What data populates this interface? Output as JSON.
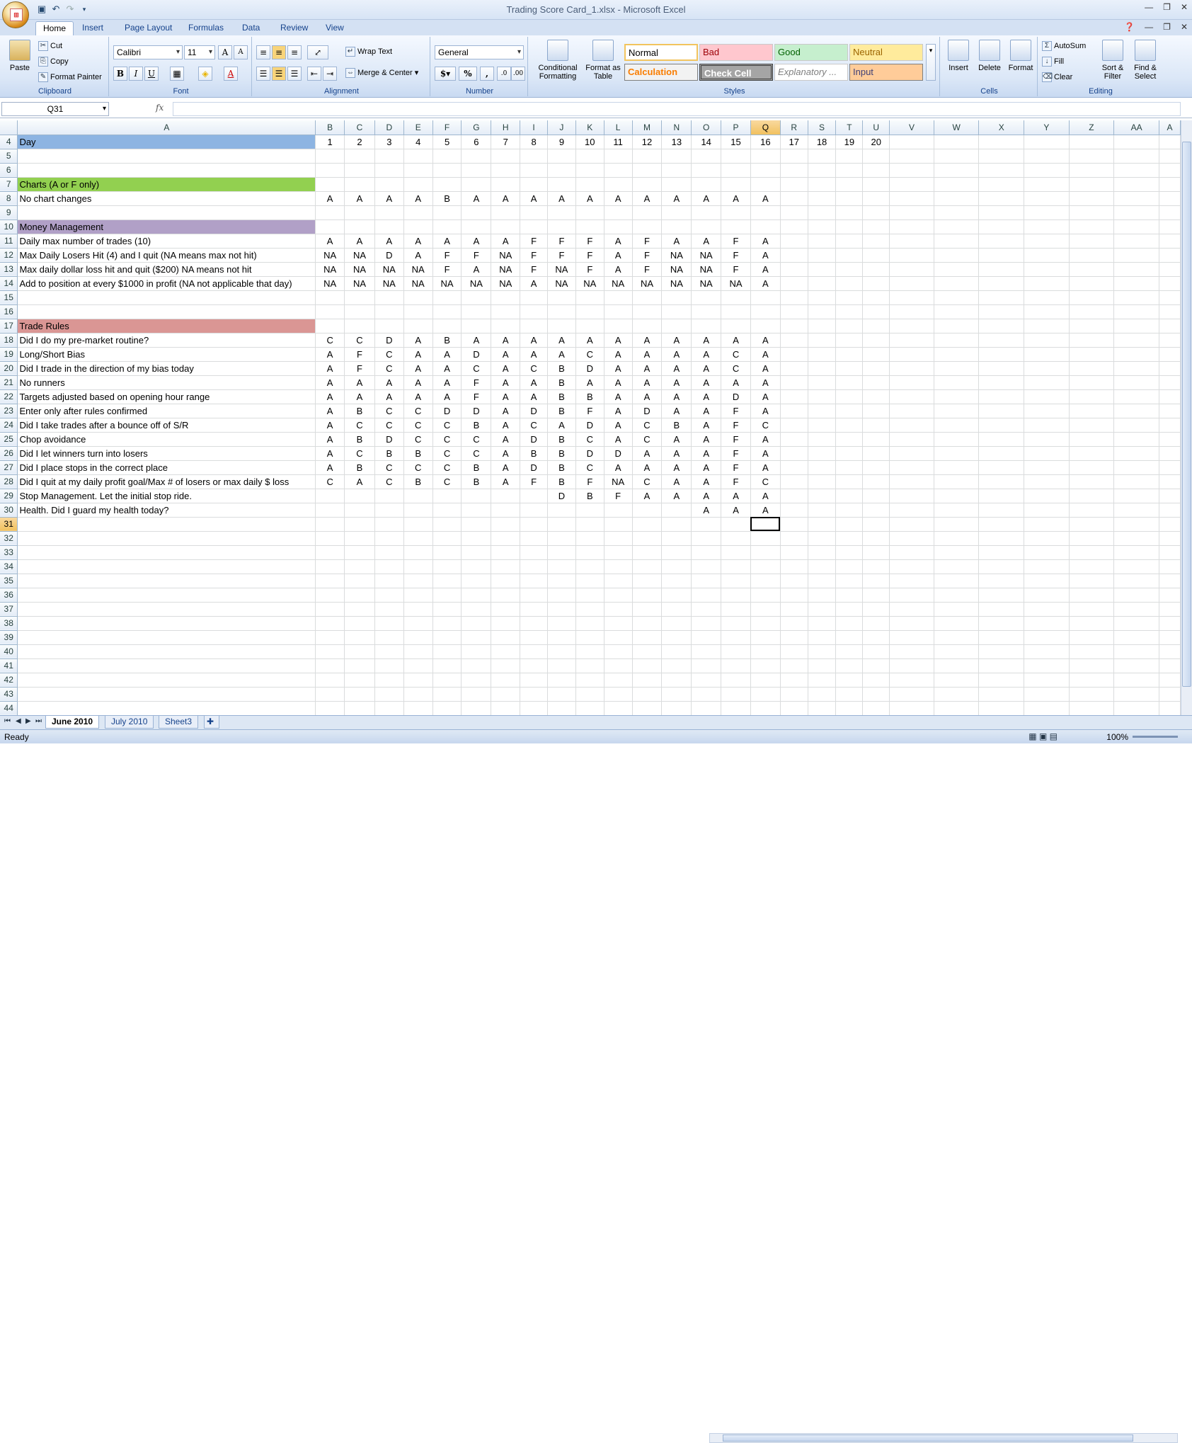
{
  "window": {
    "title": "Trading Score Card_1.xlsx - Microsoft Excel"
  },
  "ribbon_tabs": [
    "Home",
    "Insert",
    "Page Layout",
    "Formulas",
    "Data",
    "Review",
    "View"
  ],
  "clipboard": {
    "paste": "Paste",
    "cut": "Cut",
    "copy": "Copy",
    "format_painter": "Format Painter",
    "label": "Clipboard"
  },
  "font": {
    "name": "Calibri",
    "size": "11",
    "label": "Font"
  },
  "alignment": {
    "wrap": "Wrap Text",
    "merge": "Merge & Center",
    "label": "Alignment"
  },
  "number": {
    "format": "General",
    "label": "Number"
  },
  "styles": {
    "conditional": "Conditional Formatting",
    "format_table": "Format as Table",
    "normal": "Normal",
    "bad": "Bad",
    "good": "Good",
    "neutral": "Neutral",
    "calculation": "Calculation",
    "check_cell": "Check Cell",
    "explanatory": "Explanatory ...",
    "input": "Input",
    "label": "Styles",
    "colors": {
      "bad_bg": "#ffc7ce",
      "bad_fg": "#9c0006",
      "good_bg": "#c6efce",
      "good_fg": "#006100",
      "neutral_bg": "#ffeb9c",
      "neutral_fg": "#9c6500",
      "calc_fg": "#fa7d00",
      "check_bg": "#a5a5a5",
      "input_bg": "#ffcc99"
    }
  },
  "cells_group": {
    "insert": "Insert",
    "delete": "Delete",
    "format": "Format",
    "label": "Cells"
  },
  "editing": {
    "autosum": "AutoSum",
    "fill": "Fill",
    "clear": "Clear",
    "sort": "Sort & Filter",
    "find": "Find & Select",
    "label": "Editing"
  },
  "formula_bar": {
    "name_box": "Q31",
    "fx": "fx",
    "content": ""
  },
  "columns": [
    "A",
    "B",
    "C",
    "D",
    "E",
    "F",
    "G",
    "H",
    "I",
    "J",
    "K",
    "L",
    "M",
    "N",
    "O",
    "P",
    "Q",
    "R",
    "S",
    "T",
    "U",
    "V",
    "W",
    "X",
    "Y",
    "Z",
    "AA",
    "A"
  ],
  "selected_column": "Q",
  "selected_row": "31",
  "rows": [
    {
      "n": "4",
      "a": "Day",
      "fill": "#8db4e2",
      "v": [
        "1",
        "2",
        "3",
        "4",
        "5",
        "6",
        "7",
        "8",
        "9",
        "10",
        "11",
        "12",
        "13",
        "14",
        "15",
        "16",
        "17",
        "18",
        "19",
        "20"
      ]
    },
    {
      "n": "5",
      "a": "",
      "v": []
    },
    {
      "n": "6",
      "a": "",
      "v": []
    },
    {
      "n": "7",
      "a": "Charts   (A or F only)",
      "fill": "#92d050",
      "v": []
    },
    {
      "n": "8",
      "a": "No chart changes",
      "v": [
        "A",
        "A",
        "A",
        "A",
        "B",
        "A",
        "A",
        "A",
        "A",
        "A",
        "A",
        "A",
        "A",
        "A",
        "A",
        "A"
      ]
    },
    {
      "n": "9",
      "a": "",
      "v": []
    },
    {
      "n": "10",
      "a": "Money Management",
      "fill": "#b1a0c7",
      "v": []
    },
    {
      "n": "11",
      "a": "Daily max number of trades (10)",
      "v": [
        "A",
        "A",
        "A",
        "A",
        "A",
        "A",
        "A",
        "F",
        "F",
        "F",
        "A",
        "F",
        "A",
        "A",
        "F",
        "A"
      ]
    },
    {
      "n": "12",
      "a": "Max Daily Losers Hit (4) and I quit   (NA means max not hit)",
      "v": [
        "NA",
        "NA",
        "D",
        "A",
        "F",
        "F",
        "NA",
        "F",
        "F",
        "F",
        "A",
        "F",
        "NA",
        "NA",
        "F",
        "A"
      ]
    },
    {
      "n": "13",
      "a": "Max daily dollar loss hit and quit ($200) NA means not hit",
      "v": [
        "NA",
        "NA",
        "NA",
        "NA",
        "F",
        "A",
        "NA",
        "F",
        "NA",
        "F",
        "A",
        "F",
        "NA",
        "NA",
        "F",
        "A"
      ]
    },
    {
      "n": "14",
      "a": "Add to position at every $1000 in profit (NA not applicable that day)",
      "v": [
        "NA",
        "NA",
        "NA",
        "NA",
        "NA",
        "NA",
        "NA",
        "A",
        "NA",
        "NA",
        "NA",
        "NA",
        "NA",
        "NA",
        "NA",
        "A"
      ]
    },
    {
      "n": "15",
      "a": "",
      "v": []
    },
    {
      "n": "16",
      "a": "",
      "v": []
    },
    {
      "n": "17",
      "a": "Trade Rules",
      "fill": "#da9694",
      "v": []
    },
    {
      "n": "18",
      "a": "Did I do my pre-market routine?",
      "v": [
        "C",
        "C",
        "D",
        "A",
        "B",
        "A",
        "A",
        "A",
        "A",
        "A",
        "A",
        "A",
        "A",
        "A",
        "A",
        "A"
      ]
    },
    {
      "n": "19",
      "a": "Long/Short Bias",
      "v": [
        "A",
        "F",
        "C",
        "A",
        "A",
        "D",
        "A",
        "A",
        "A",
        "C",
        "A",
        "A",
        "A",
        "A",
        "C",
        "A"
      ]
    },
    {
      "n": "20",
      "a": "Did I trade in the direction of my bias today",
      "v": [
        "A",
        "F",
        "C",
        "A",
        "A",
        "C",
        "A",
        "C",
        "B",
        "D",
        "A",
        "A",
        "A",
        "A",
        "C",
        "A"
      ]
    },
    {
      "n": "21",
      "a": "No runners",
      "v": [
        "A",
        "A",
        "A",
        "A",
        "A",
        "F",
        "A",
        "A",
        "B",
        "A",
        "A",
        "A",
        "A",
        "A",
        "A",
        "A"
      ]
    },
    {
      "n": "22",
      "a": "Targets adjusted based on opening hour range",
      "v": [
        "A",
        "A",
        "A",
        "A",
        "A",
        "F",
        "A",
        "A",
        "B",
        "B",
        "A",
        "A",
        "A",
        "A",
        "D",
        "A"
      ]
    },
    {
      "n": "23",
      "a": "Enter only after rules confirmed",
      "v": [
        "A",
        "B",
        "C",
        "C",
        "D",
        "D",
        "A",
        "D",
        "B",
        "F",
        "A",
        "D",
        "A",
        "A",
        "F",
        "A"
      ]
    },
    {
      "n": "24",
      "a": "Did I take trades after a bounce off of S/R",
      "v": [
        "A",
        "C",
        "C",
        "C",
        "C",
        "B",
        "A",
        "C",
        "A",
        "D",
        "A",
        "C",
        "B",
        "A",
        "F",
        "C"
      ]
    },
    {
      "n": "25",
      "a": "Chop avoidance",
      "v": [
        "A",
        "B",
        "D",
        "C",
        "C",
        "C",
        "A",
        "D",
        "B",
        "C",
        "A",
        "C",
        "A",
        "A",
        "F",
        "A"
      ]
    },
    {
      "n": "26",
      "a": "Did I let winners turn into losers",
      "v": [
        "A",
        "C",
        "B",
        "B",
        "C",
        "C",
        "A",
        "B",
        "B",
        "D",
        "D",
        "A",
        "A",
        "A",
        "F",
        "A"
      ]
    },
    {
      "n": "27",
      "a": "Did I place stops in the correct place",
      "v": [
        "A",
        "B",
        "C",
        "C",
        "C",
        "B",
        "A",
        "D",
        "B",
        "C",
        "A",
        "A",
        "A",
        "A",
        "F",
        "A"
      ]
    },
    {
      "n": "28",
      "a": "Did I quit at my daily profit goal/Max # of losers or max daily $ loss",
      "v": [
        "C",
        "A",
        "C",
        "B",
        "C",
        "B",
        "A",
        "F",
        "B",
        "F",
        "NA",
        "C",
        "A",
        "A",
        "F",
        "C"
      ]
    },
    {
      "n": "29",
      "a": "Stop Management. Let the initial stop ride.",
      "v": [
        "",
        "",
        "",
        "",
        "",
        "",
        "",
        "",
        "D",
        "B",
        "F",
        "A",
        "A",
        "A",
        "A",
        "A"
      ]
    },
    {
      "n": "30",
      "a": "Health. Did I guard my health today?",
      "v": [
        "",
        "",
        "",
        "",
        "",
        "",
        "",
        "",
        "",
        "",
        "",
        "",
        "",
        "A",
        "A",
        "A"
      ]
    },
    {
      "n": "31",
      "a": "",
      "v": []
    },
    {
      "n": "32",
      "a": "",
      "v": []
    },
    {
      "n": "33",
      "a": "",
      "v": []
    },
    {
      "n": "34",
      "a": "",
      "v": []
    },
    {
      "n": "35",
      "a": "",
      "v": []
    },
    {
      "n": "36",
      "a": "",
      "v": []
    },
    {
      "n": "37",
      "a": "",
      "v": []
    },
    {
      "n": "38",
      "a": "",
      "v": []
    },
    {
      "n": "39",
      "a": "",
      "v": []
    },
    {
      "n": "40",
      "a": "",
      "v": []
    },
    {
      "n": "41",
      "a": "",
      "v": []
    },
    {
      "n": "42",
      "a": "",
      "v": []
    },
    {
      "n": "43",
      "a": "",
      "v": []
    },
    {
      "n": "44",
      "a": "",
      "v": []
    }
  ],
  "sheets": [
    "June 2010",
    "July 2010",
    "Sheet3"
  ],
  "active_sheet": "June 2010",
  "status": {
    "text": "Ready",
    "zoom": "100%"
  }
}
